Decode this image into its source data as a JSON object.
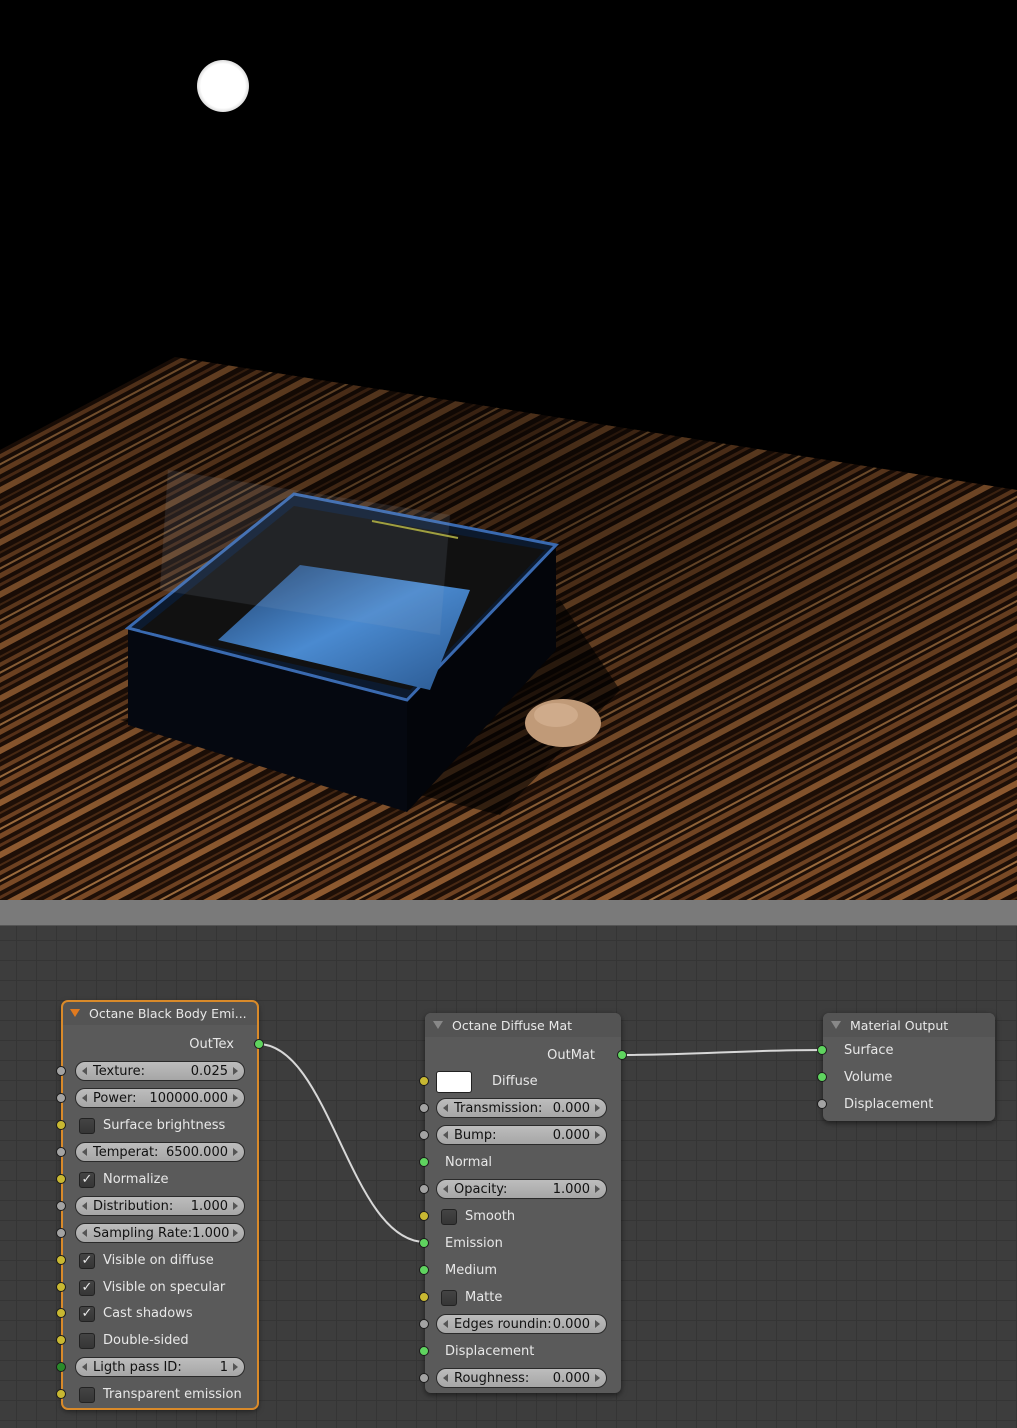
{
  "render": {
    "description": "3D render viewport"
  },
  "nodes": {
    "blackbody": {
      "title": "Octane Black Body Emi...",
      "output": "OutTex",
      "texture": {
        "label": "Texture:",
        "value": "0.025"
      },
      "power": {
        "label": "Power:",
        "value": "100000.000"
      },
      "surface_brightness": {
        "label": "Surface brightness",
        "checked": false
      },
      "temperature": {
        "label": "Temperat:",
        "value": "6500.000"
      },
      "normalize": {
        "label": "Normalize",
        "checked": true
      },
      "distribution": {
        "label": "Distribution:",
        "value": "1.000"
      },
      "sampling_rate": {
        "label": "Sampling Rate:",
        "value": "1.000"
      },
      "visible_diffuse": {
        "label": "Visible on diffuse",
        "checked": true
      },
      "visible_specular": {
        "label": "Visible on specular",
        "checked": true
      },
      "cast_shadows": {
        "label": "Cast shadows",
        "checked": true
      },
      "double_sided": {
        "label": "Double-sided",
        "checked": false
      },
      "light_pass_id": {
        "label": "Ligth pass ID:",
        "value": "1"
      },
      "transparent_emission": {
        "label": "Transparent emission",
        "checked": false
      }
    },
    "diffuse": {
      "title": "Octane Diffuse Mat",
      "output": "OutMat",
      "diffuse": {
        "label": "Diffuse",
        "color": "#ffffff"
      },
      "transmission": {
        "label": "Transmission:",
        "value": "0.000"
      },
      "bump": {
        "label": "Bump:",
        "value": "0.000"
      },
      "normal": {
        "label": "Normal"
      },
      "opacity": {
        "label": "Opacity:",
        "value": "1.000"
      },
      "smooth": {
        "label": "Smooth",
        "checked": false
      },
      "emission": {
        "label": "Emission"
      },
      "medium": {
        "label": "Medium"
      },
      "matte": {
        "label": "Matte",
        "checked": false
      },
      "edges_rounding": {
        "label": "Edges roundin:",
        "value": "0.000"
      },
      "displacement": {
        "label": "Displacement"
      },
      "roughness": {
        "label": "Roughness:",
        "value": "0.000"
      }
    },
    "output": {
      "title": "Material Output",
      "surface": "Surface",
      "volume": "Volume",
      "displacement": "Displacement"
    }
  },
  "colors": {
    "selected_outline": "#d98a2a",
    "socket_yellow": "#c8b832",
    "socket_gray": "#a3a3a3",
    "socket_green": "#5fd45f"
  }
}
